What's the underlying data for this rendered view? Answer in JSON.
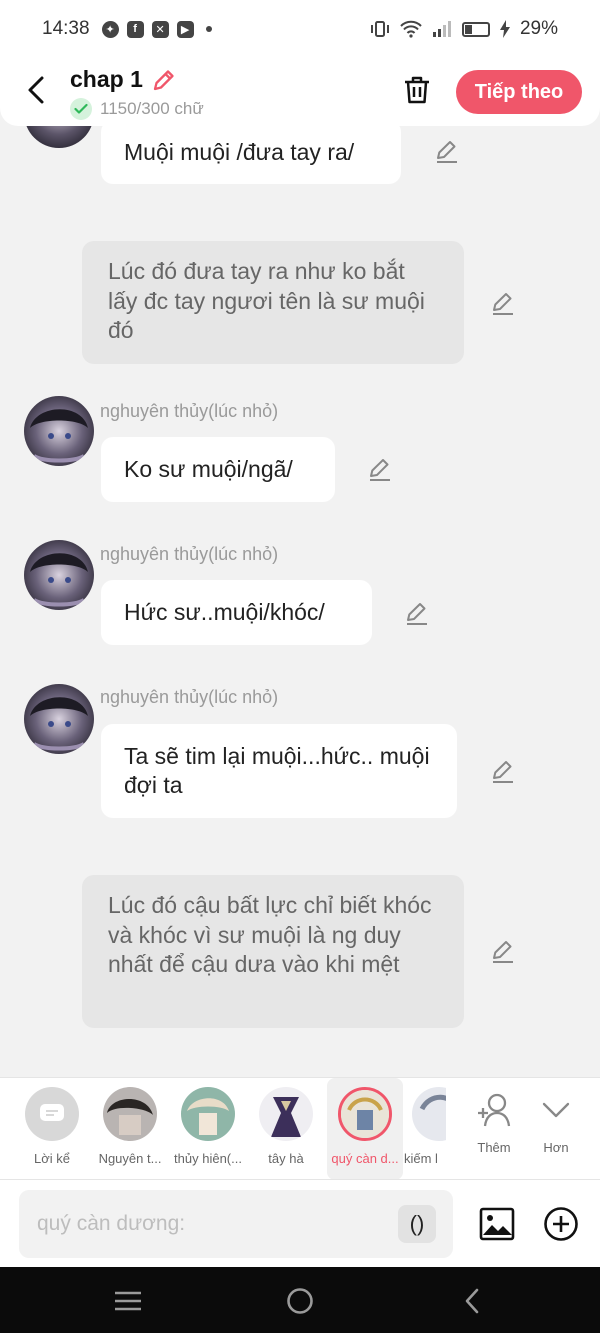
{
  "status_bar": {
    "time": "14:38",
    "battery": "29%",
    "app_icons": [
      "messenger-icon",
      "facebook-icon",
      "capcut-icon",
      "youtube-icon"
    ]
  },
  "header": {
    "title": "chap 1",
    "word_count": "1150/300 chữ",
    "next_label": "Tiếp theo"
  },
  "messages": [
    {
      "type": "dialogue",
      "text": "Muội muội /đưa tay ra/"
    },
    {
      "type": "narration",
      "text": "Lúc đó đưa tay ra như ko bắt lấy đc tay ngươi tên là sư muội đó"
    },
    {
      "type": "dialogue",
      "name": "nghuyên thủy(lúc nhỏ)",
      "text": "Ko sư muội/ngã/"
    },
    {
      "type": "dialogue",
      "name": "nghuyên thủy(lúc nhỏ)",
      "text": "Hức sư..muội/khóc/"
    },
    {
      "type": "dialogue",
      "name": "nghuyên thủy(lúc nhỏ)",
      "text": "Ta sẽ tim lại muội...hức.. muội đợi ta"
    },
    {
      "type": "narration",
      "text": "Lúc đó cậu bất lực chỉ biết khóc và khóc vì sư muội là ng duy nhất để cậu dưa vào khi mệt"
    }
  ],
  "characters": [
    {
      "label": "Lời kể"
    },
    {
      "label": "Nguyên t..."
    },
    {
      "label": "thủy hiên(..."
    },
    {
      "label": "tây hà"
    },
    {
      "label": "quý càn d...",
      "selected": true
    },
    {
      "label": "kiếm l"
    }
  ],
  "strip_actions": {
    "more_label": "Thêm",
    "expand_label": "Hơn"
  },
  "input": {
    "placeholder": "quý càn dương:",
    "paren_label": "()"
  },
  "colors": {
    "accent": "#f0566a",
    "background": "#f2f2f2",
    "narration_bg": "#e6e6e6",
    "nav_bar": "#0b0b0b"
  }
}
